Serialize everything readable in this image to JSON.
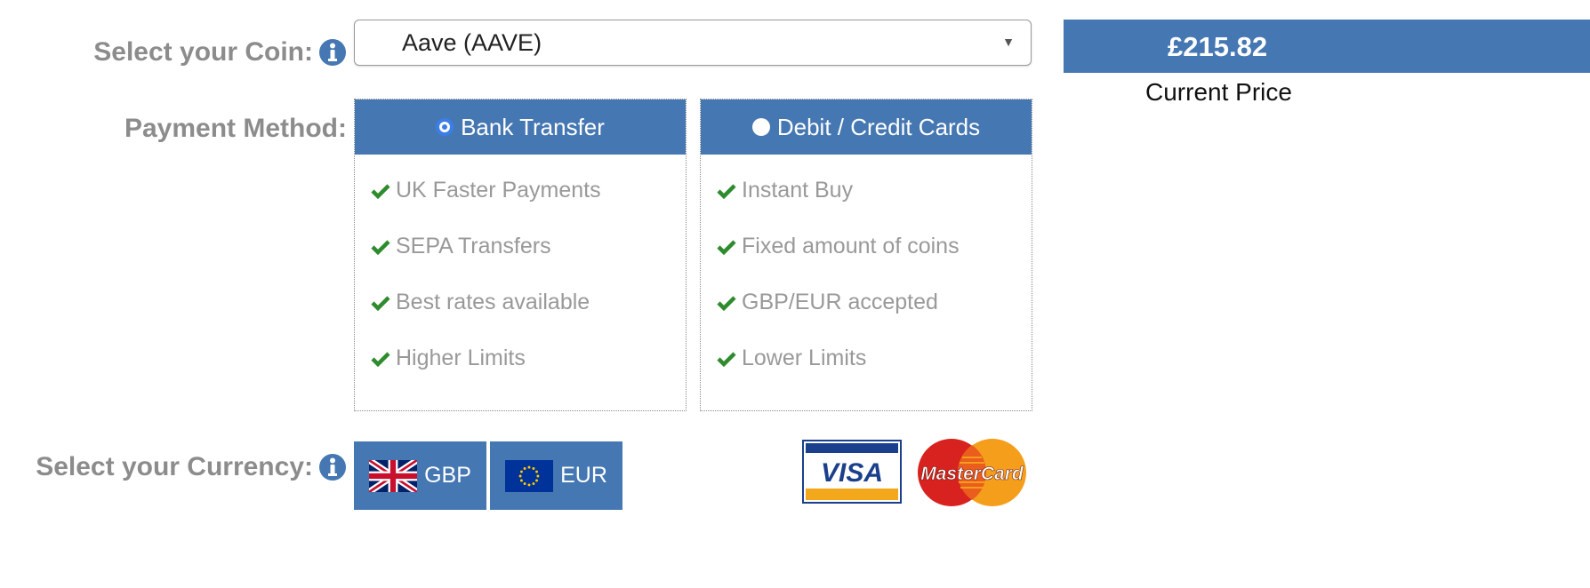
{
  "coin": {
    "label": "Select your Coin:",
    "icon": "info-icon",
    "selected": "Aave (AAVE)"
  },
  "price": {
    "value": "£215.82",
    "caption": "Current Price"
  },
  "payment": {
    "label": "Payment Method:",
    "options": [
      {
        "title": "Bank Transfer",
        "selected": true,
        "features": [
          "UK Faster Payments",
          "SEPA Transfers",
          "Best rates available",
          "Higher Limits"
        ]
      },
      {
        "title": "Debit / Credit Cards",
        "selected": false,
        "features": [
          "Instant Buy",
          "Fixed amount of coins",
          "GBP/EUR accepted",
          "Lower Limits"
        ]
      }
    ]
  },
  "currency": {
    "label": "Select your Currency:",
    "icon": "info-icon",
    "options": [
      {
        "code": "GBP",
        "icon": "uk-flag-icon"
      },
      {
        "code": "EUR",
        "icon": "eu-flag-icon"
      }
    ]
  },
  "card_logos": {
    "visa": "VISA",
    "mastercard": "MasterCard"
  },
  "colors": {
    "accent": "#4577b2",
    "check": "#2e8b2e",
    "label": "#8c8c8c"
  }
}
